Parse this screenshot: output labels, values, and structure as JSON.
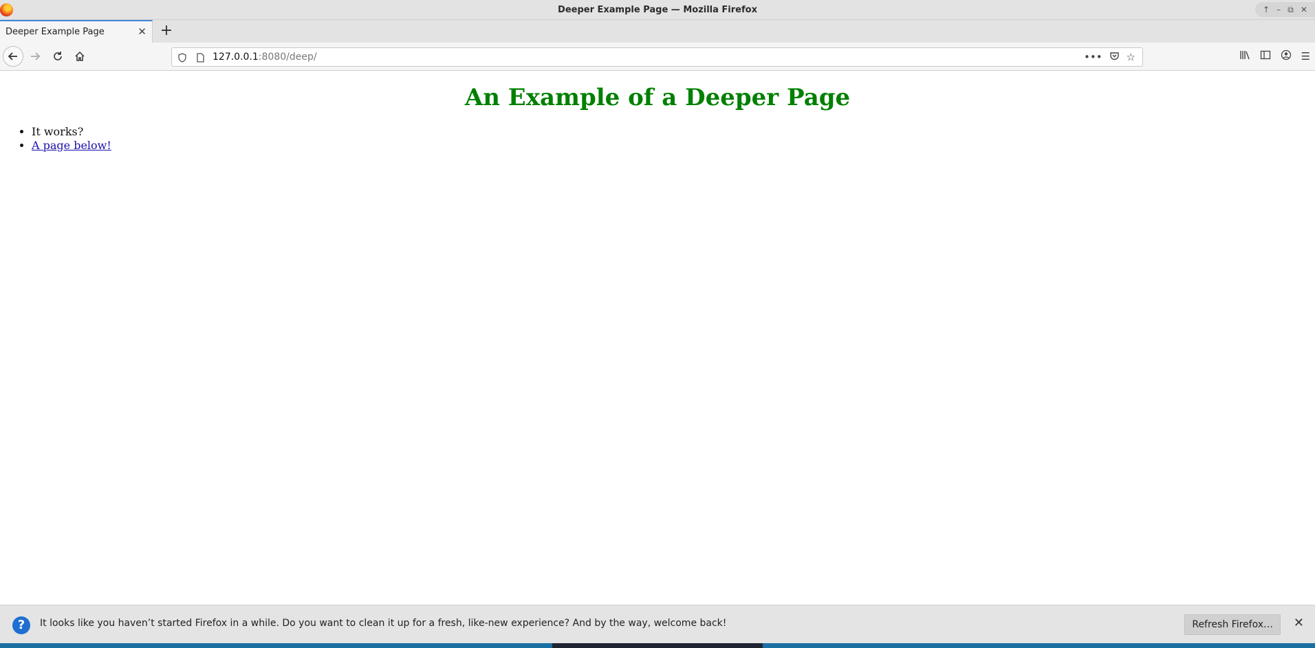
{
  "window": {
    "title": "Deeper Example Page — Mozilla Firefox",
    "controls": [
      "↑",
      "–",
      "⧉",
      "✕"
    ]
  },
  "tabs": [
    {
      "label": "Deeper Example Page",
      "active": true
    }
  ],
  "toolbar": {
    "new_tab_label": "+",
    "url_host": "127.0.0.1",
    "url_rest": ":8080/deep/"
  },
  "page": {
    "heading": "An Example of a Deeper Page",
    "heading_color": "#008000",
    "list": [
      {
        "text": "It works?",
        "is_link": false
      },
      {
        "text": "A page below!",
        "is_link": true
      }
    ]
  },
  "notification": {
    "message": "It looks like you haven’t started Firefox in a while. Do you want to clean it up for a fresh, like-new experience? And by the way, welcome back!",
    "button_label": "Refresh Firefox…",
    "close_label": "✕"
  },
  "colors": {
    "tab_accent": "#3f86d6",
    "link": "#1a0dab",
    "notify_icon": "#1f6fd1"
  }
}
